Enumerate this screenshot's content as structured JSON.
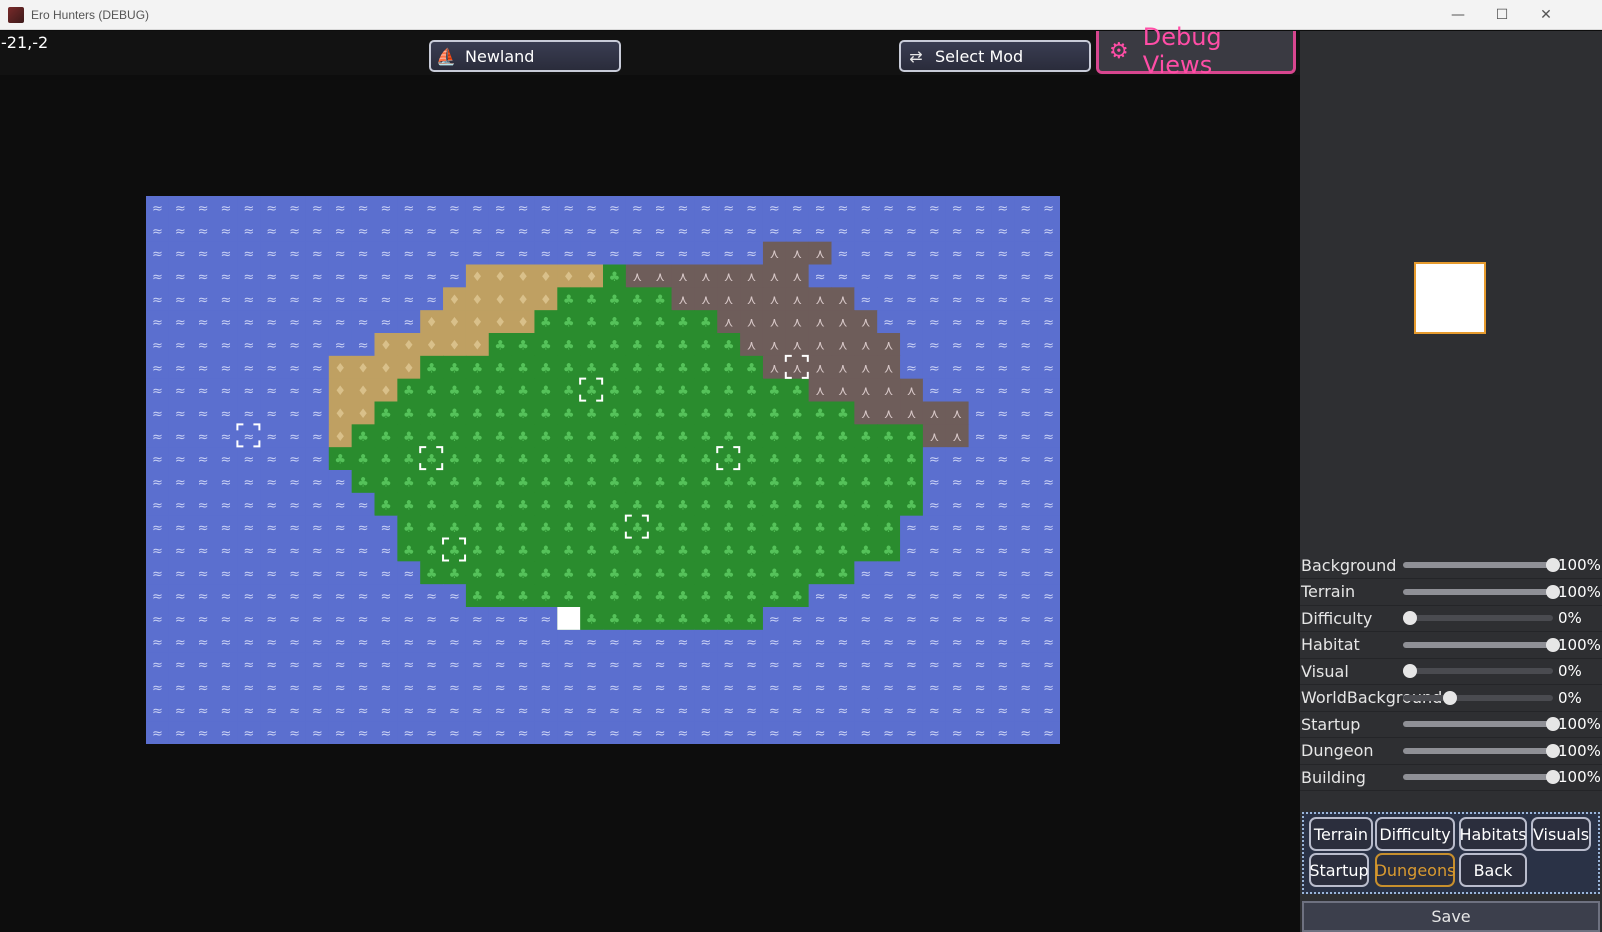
{
  "window": {
    "title": "Ero Hunters (DEBUG)",
    "controls": {
      "minimize": "—",
      "maximize": "☐",
      "close": "✕"
    }
  },
  "hud": {
    "coords": "-21,-2",
    "region_button": {
      "label": "Newland",
      "icon": "ship-icon"
    },
    "mod_button": {
      "label": "Select Mod",
      "icon": "swap-icon"
    },
    "debug_button": {
      "label": "Debug Views",
      "icon": "gear-icon"
    }
  },
  "map": {
    "colors": {
      "water": "#5b6fcf",
      "grass": "#2a8c2e",
      "sand": "#bfa062",
      "rock": "#6e5d5a",
      "marker": "#ffffff"
    },
    "tiles": [
      "........................................",
      "........................................",
      "........................................",
      "..........................................",
      "........................................",
      "........................................",
      "........................................",
      "........................................",
      "........................................",
      "........................................",
      "........................................",
      "........................................",
      "........................................",
      "........................................",
      "........................................",
      "........................................",
      "........................................",
      "........................................",
      "........................................",
      "........................................",
      "........................................",
      "........................................",
      "........................................",
      "........................................"
    ],
    "rows": [
      "........................................",
      "........................................",
      "...........................RRR..........",
      "..............SSSSSSGRRRRRRRR...........",
      ".............SSSSSGGGGGRRRRRRRR.........",
      "............SSSSSGGGGGGGGRRRRRRR........",
      "..........SSSSSGGGGGGGGGGGRRRRRRR.......",
      "........SSSSGGGGGGGGGGGGGGGRRRRRR.......",
      "........SSSGGGGGGGGGGGGGGGGGGRRRRR......",
      "........SSGGGGGGGGGGGGGGGGGGGGGRRRRR....",
      "........SGGGGGGGGGGGGGGGGGGGGGGGGGRR....",
      "........GGGGGGGGGGGGGGGGGGGGGGGGGG......",
      ".........GGGGGGGGGGGGGGGGGGGGGGGGG......",
      "..........GGGGGGGGGGGGGGGGGGGGGGGG......",
      "...........GGGGGGGGGGGGGGGGGGGGGG.......",
      "...........GGGGGGGGGGGGGGGGGGGGGG.......",
      "............GGGGGGGGGGGGGGGGGGG.........",
      "..............GGGGGGGGGGGGGGG...........",
      "..................GGGGGGGGG.............",
      "........................................",
      "........................................",
      "........................................",
      "........................................",
      "........................................"
    ],
    "dungeon_markers": [
      [
        4,
        10
      ],
      [
        19,
        8
      ],
      [
        12,
        11
      ],
      [
        25,
        11
      ],
      [
        28,
        7
      ],
      [
        21,
        14
      ],
      [
        13,
        15
      ]
    ],
    "player_marker": [
      18,
      18
    ]
  },
  "preview": {
    "swatch": "#ffffff"
  },
  "layers": [
    {
      "label": "Background",
      "value": 100,
      "display": "100%"
    },
    {
      "label": "Terrain",
      "value": 100,
      "display": "100%"
    },
    {
      "label": "Difficulty",
      "value": 0,
      "display": "0%"
    },
    {
      "label": "Habitat",
      "value": 100,
      "display": "100%"
    },
    {
      "label": "Visual",
      "value": 0,
      "display": "0%"
    },
    {
      "label": "WorldBackground",
      "value": 0,
      "display": "0%"
    },
    {
      "label": "Startup",
      "value": 100,
      "display": "100%"
    },
    {
      "label": "Dungeon",
      "value": 100,
      "display": "100%"
    },
    {
      "label": "Building",
      "value": 100,
      "display": "100%"
    }
  ],
  "view_buttons": [
    {
      "label": "Terrain",
      "active": false
    },
    {
      "label": "Difficulty",
      "active": false
    },
    {
      "label": "Habitats",
      "active": false
    },
    {
      "label": "Visuals",
      "active": false
    },
    {
      "label": "Startup",
      "active": false
    },
    {
      "label": "Dungeons",
      "active": true
    },
    {
      "label": "Back",
      "active": false
    }
  ],
  "save_label": "Save"
}
